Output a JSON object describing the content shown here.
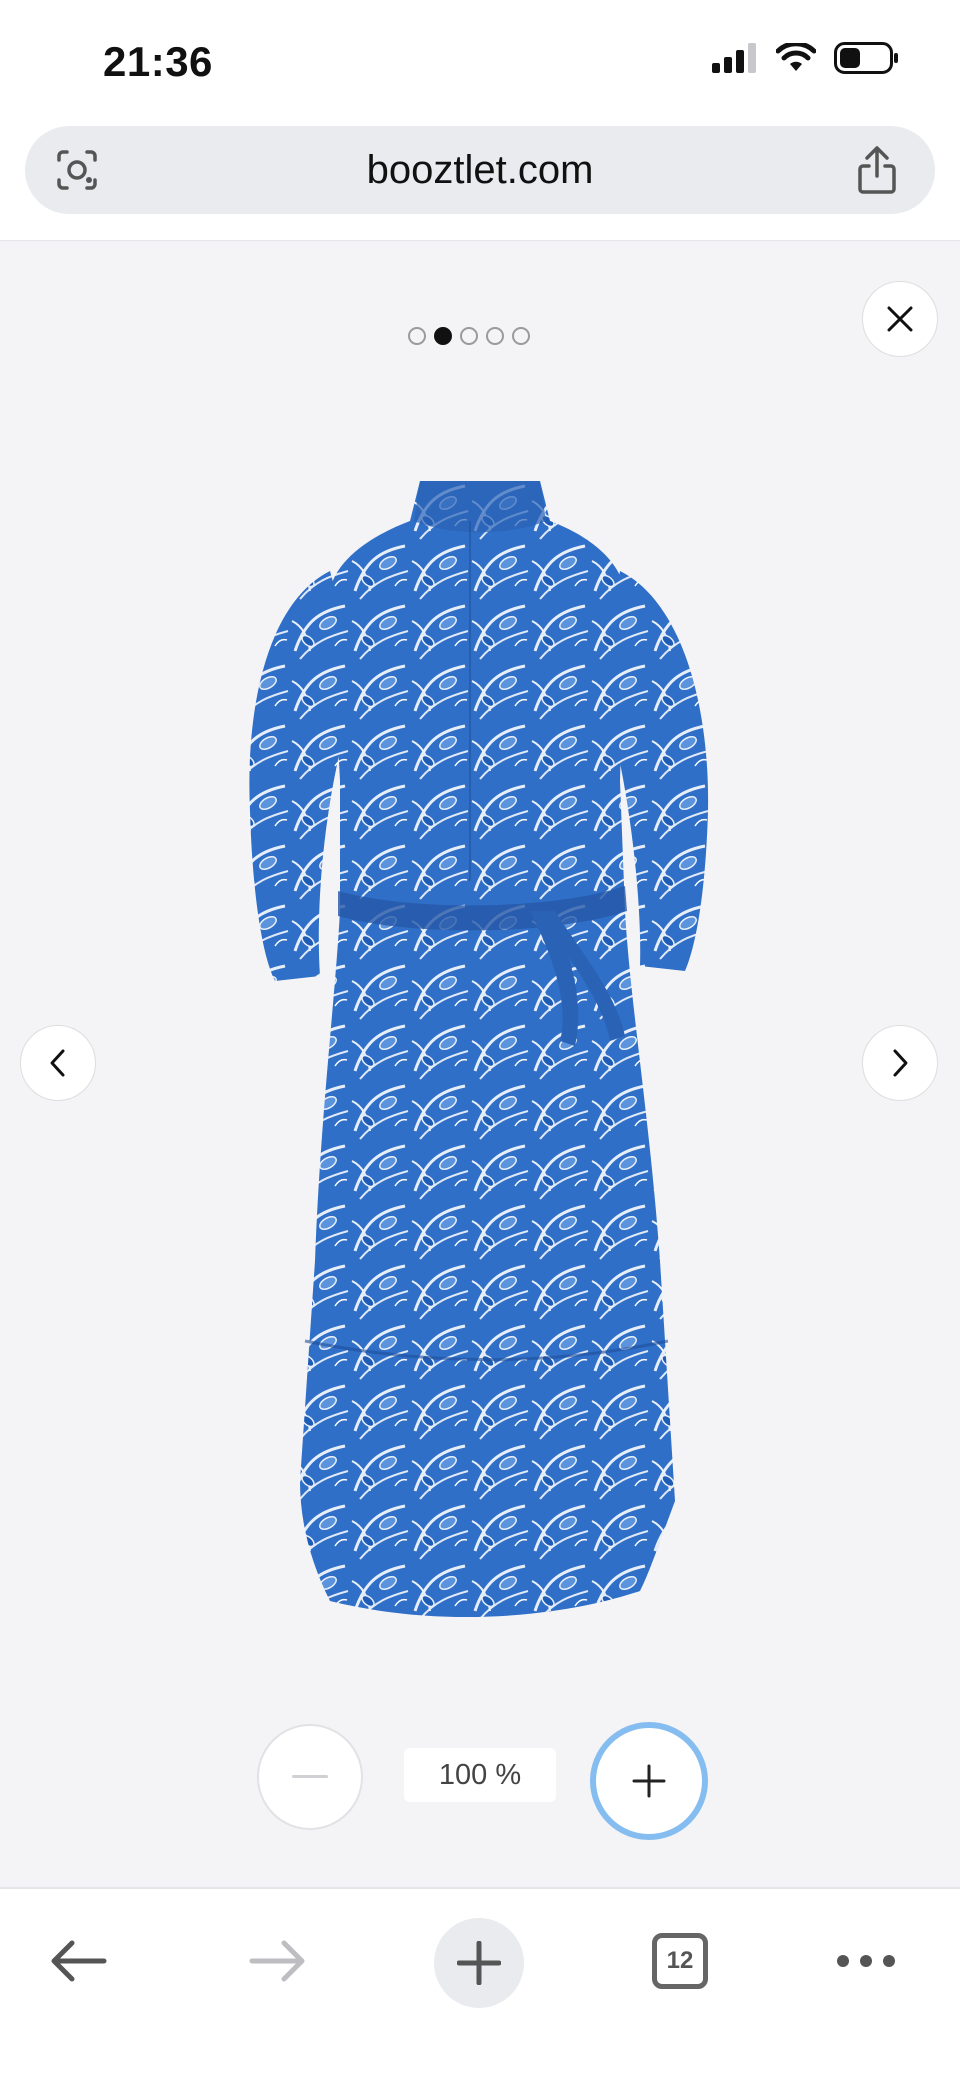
{
  "status_bar": {
    "time": "21:36"
  },
  "address_bar": {
    "url": "booztlet.com"
  },
  "viewer": {
    "image_count": 5,
    "active_index": 1,
    "product_image_alt": "Blue and white floral print midi dress with tie belt",
    "zoom_level": "100 %"
  },
  "toolbar": {
    "tab_count": "12"
  },
  "colors": {
    "accent": "#86bdf0",
    "dress_blue": "#2f6fc7",
    "background": "#f4f4f6"
  },
  "icons": [
    "camera-search-icon",
    "share-icon",
    "close-icon",
    "chevron-left-icon",
    "chevron-right-icon",
    "minus-icon",
    "plus-icon",
    "back-arrow-icon",
    "forward-arrow-icon",
    "new-tab-plus-icon",
    "tabs-icon",
    "more-icon"
  ]
}
